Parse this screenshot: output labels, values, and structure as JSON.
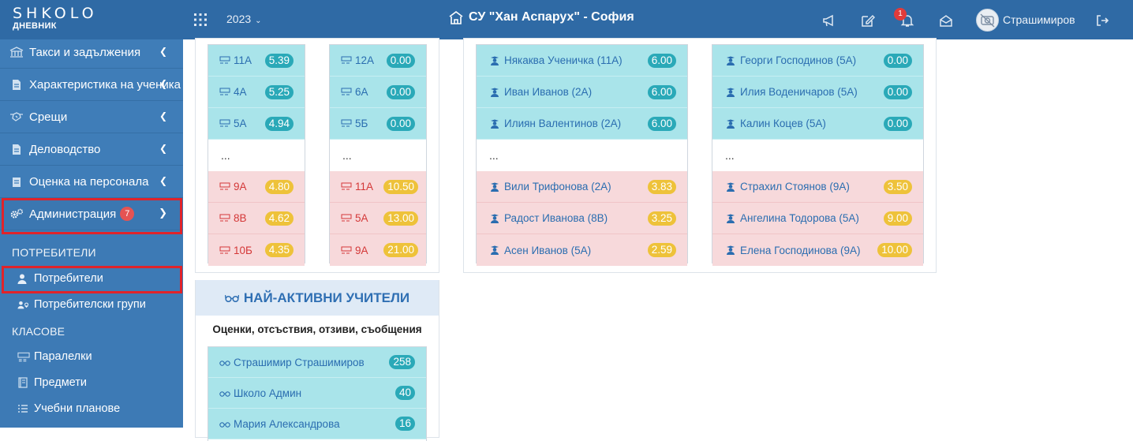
{
  "header": {
    "logo_text": "SHKOLO",
    "logo_sub": "ДНЕВНИК",
    "year": "2023",
    "school": "СУ \"Хан Аспарух\" - София",
    "notifications_count": "1",
    "username": "Страшимиров"
  },
  "sidebar": {
    "items": [
      {
        "label": "Такси и задължения"
      },
      {
        "label": "Характеристика на ученика"
      },
      {
        "label": "Срещи"
      },
      {
        "label": "Деловодство"
      },
      {
        "label": "Оценка на персонала"
      },
      {
        "label": "Администрация",
        "badge": "7"
      }
    ],
    "section_users": "ПОТРЕБИТЕЛИ",
    "users_items": [
      {
        "label": "Потребители"
      },
      {
        "label": "Потребителски групи"
      }
    ],
    "section_classes": "КЛАСОВЕ",
    "classes_items": [
      {
        "label": "Паралелки"
      },
      {
        "label": "Предмети"
      },
      {
        "label": "Учебни планове"
      }
    ]
  },
  "class_lists": [
    {
      "top": [
        {
          "name": "11А",
          "value": "5.39"
        },
        {
          "name": "4А",
          "value": "5.25"
        },
        {
          "name": "5А",
          "value": "4.94"
        }
      ],
      "ellipsis": "...",
      "bottom": [
        {
          "name": "9А",
          "value": "4.80"
        },
        {
          "name": "8В",
          "value": "4.62"
        },
        {
          "name": "10Б",
          "value": "4.35"
        }
      ]
    },
    {
      "top": [
        {
          "name": "12А",
          "value": "0.00"
        },
        {
          "name": "6А",
          "value": "0.00"
        },
        {
          "name": "5Б",
          "value": "0.00"
        }
      ],
      "ellipsis": "...",
      "bottom": [
        {
          "name": "11А",
          "value": "10.50"
        },
        {
          "name": "5А",
          "value": "13.00"
        },
        {
          "name": "9А",
          "value": "21.00"
        }
      ]
    }
  ],
  "student_lists": [
    {
      "top": [
        {
          "name": "Някаква Ученичка (11А)",
          "value": "6.00"
        },
        {
          "name": "Иван Иванов (2А)",
          "value": "6.00"
        },
        {
          "name": "Илиян Валентинов (2А)",
          "value": "6.00"
        }
      ],
      "ellipsis": "...",
      "bottom": [
        {
          "name": "Вили Трифонова (2А)",
          "value": "3.83"
        },
        {
          "name": "Радост Иванова (8В)",
          "value": "3.25"
        },
        {
          "name": "Асен Иванов (5А)",
          "value": "2.59"
        }
      ]
    },
    {
      "top": [
        {
          "name": "Георги Господинов (5А)",
          "value": "0.00"
        },
        {
          "name": "Илия Воденичаров (5А)",
          "value": "0.00"
        },
        {
          "name": "Калин Коцев (5А)",
          "value": "0.00"
        }
      ],
      "ellipsis": "...",
      "bottom": [
        {
          "name": "Страхил Стоянов (9А)",
          "value": "3.50"
        },
        {
          "name": "Ангелина Тодорова (5А)",
          "value": "9.00"
        },
        {
          "name": "Елена Господинова (9А)",
          "value": "10.00"
        }
      ]
    }
  ],
  "teachers": {
    "title": "НАЙ-АКТИВНИ УЧИТЕЛИ",
    "subtitle": "Оценки, отсъствия, отзиви, съобщения",
    "rows": [
      {
        "name": "Страшимир Страшимиров",
        "value": "258"
      },
      {
        "name": "Школо Админ",
        "value": "40"
      },
      {
        "name": "Мария Александрова",
        "value": "16"
      }
    ]
  },
  "colors": {
    "topbar": "#2f6aa5",
    "sidebar": "#3d7ab5",
    "row_blue": "#a9e4ea",
    "row_red": "#f7d9db",
    "pill_teal": "#2aa9b8",
    "pill_yellow": "#eec23a",
    "highlight": "#e0232a"
  }
}
